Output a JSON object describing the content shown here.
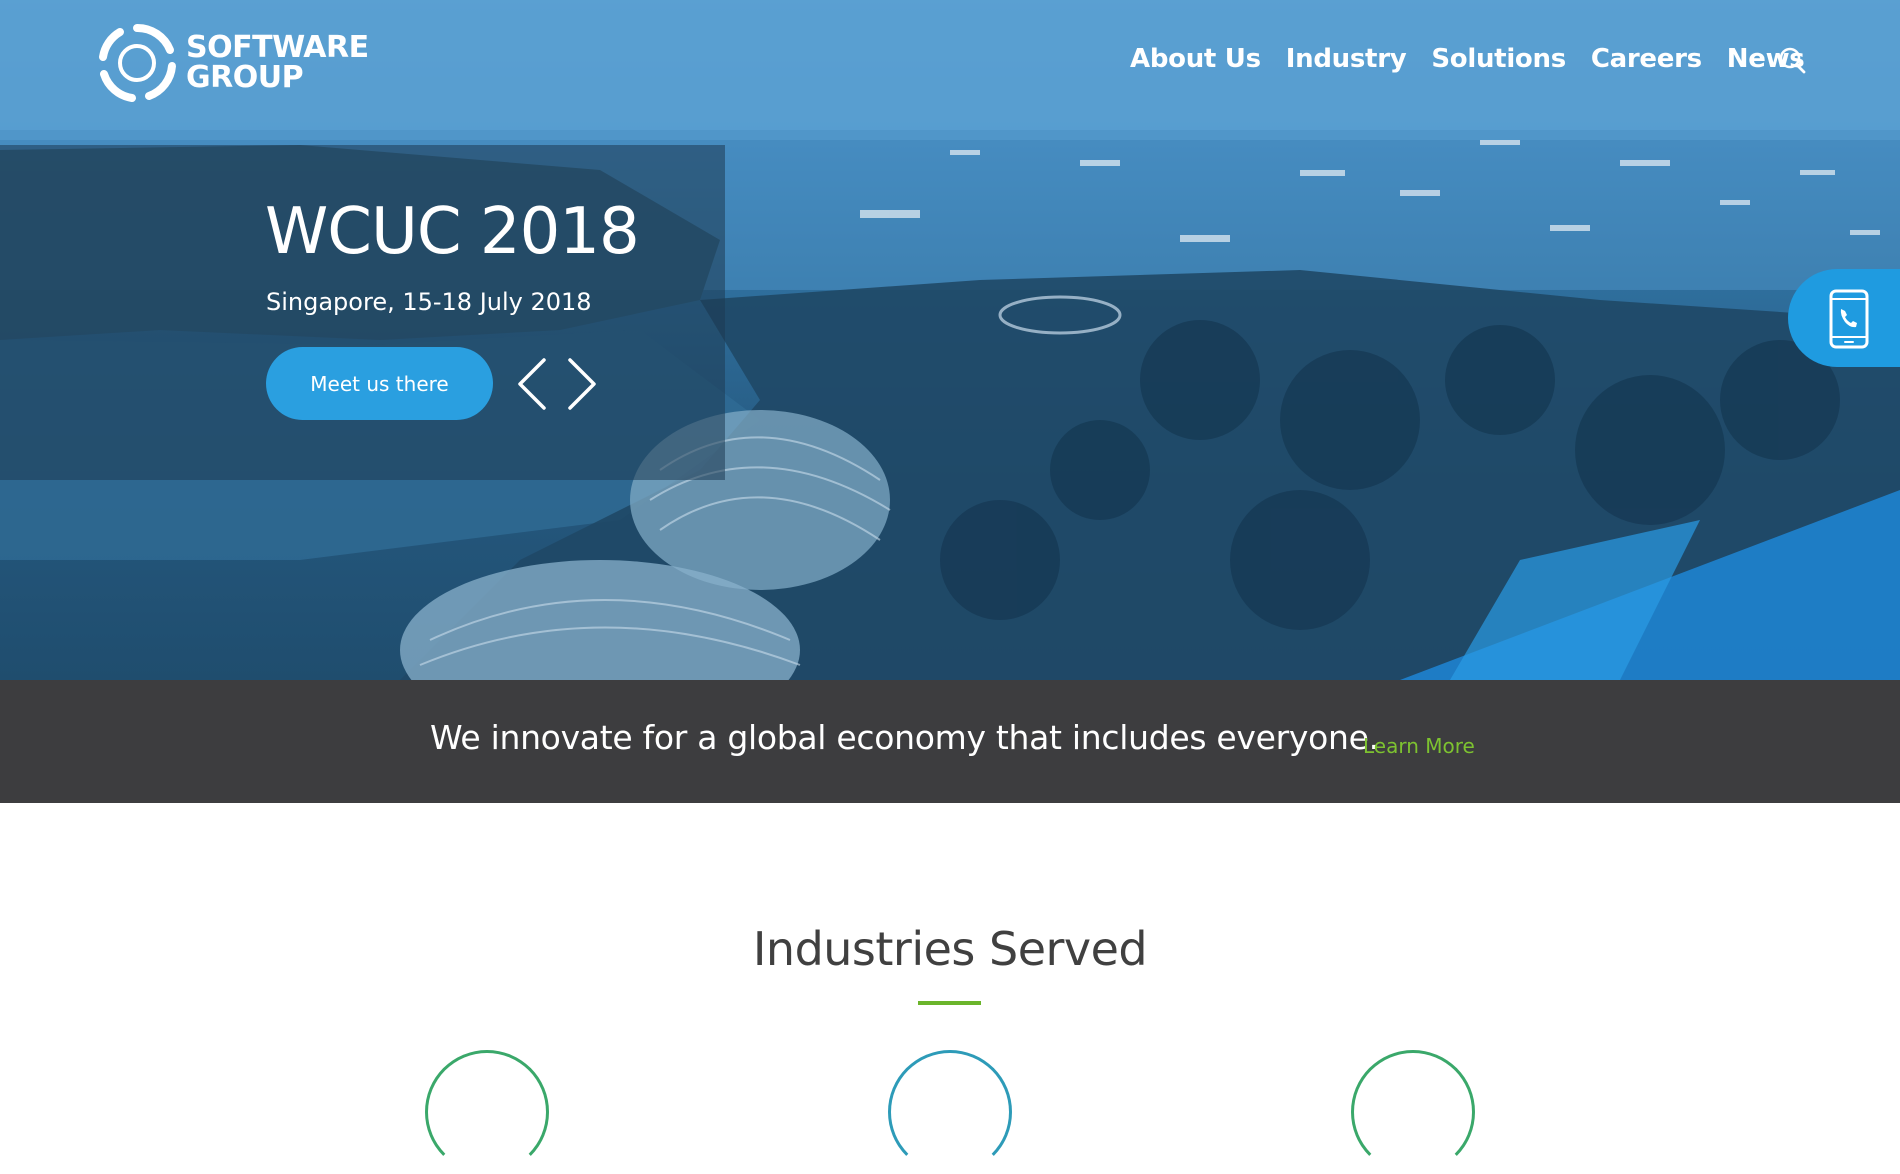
{
  "brand": {
    "logo_line1": "SOFTWARE",
    "logo_line2": "GROUP"
  },
  "nav": {
    "items": [
      {
        "label": "About Us"
      },
      {
        "label": "Industry"
      },
      {
        "label": "Solutions"
      },
      {
        "label": "Careers"
      },
      {
        "label": "News"
      }
    ],
    "search_icon": "search-icon"
  },
  "hero": {
    "title": "WCUC 2018",
    "subtitle": "Singapore, 15-18 July 2018",
    "cta_label": "Meet us there",
    "prev_icon": "chevron-left-icon",
    "next_icon": "chevron-right-icon",
    "contact_icon": "phone-icon"
  },
  "banner": {
    "text": "We innovate for a global economy that includes everyone.",
    "link_label": "Learn More"
  },
  "industries": {
    "title": "Industries Served"
  },
  "colors": {
    "accent_blue": "#2a9fe0",
    "banner_bg": "#3d3d3f",
    "link_green": "#7dc230",
    "underline_green": "#6bb52b"
  }
}
